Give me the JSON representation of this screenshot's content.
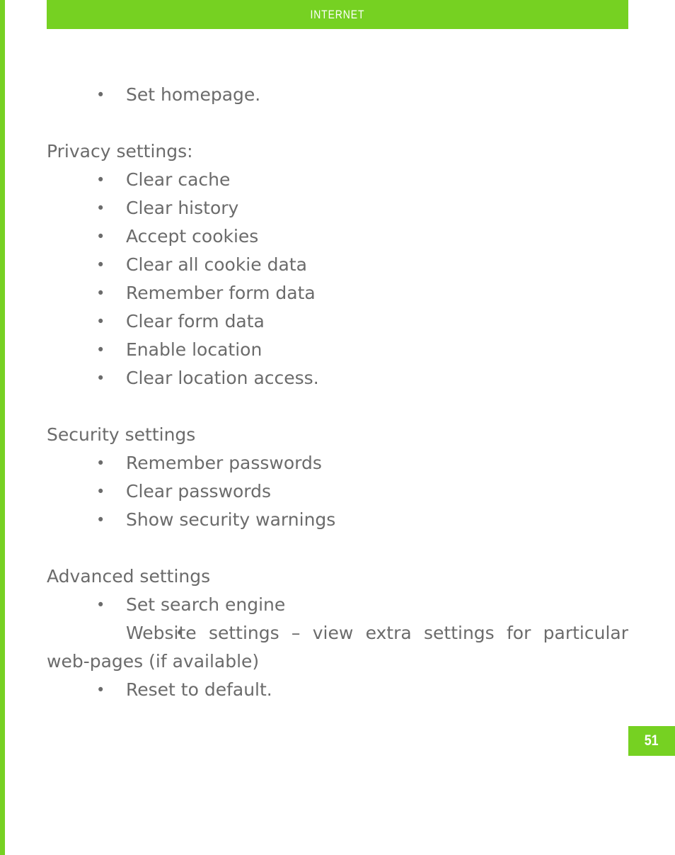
{
  "colors": {
    "accent_green": "#76d122",
    "body_text": "#6b6b6b",
    "page_background": "#ffffff",
    "header_text": "#ffffff"
  },
  "header": {
    "running_title": "INTERNET"
  },
  "content": {
    "intro_bullets": [
      "Set homepage."
    ],
    "sections": [
      {
        "heading": "Privacy settings:",
        "items": [
          "Clear cache",
          "Clear history",
          "Accept cookies",
          "Clear all cookie data",
          "Remember form data",
          "Clear form data",
          "Enable location",
          "Clear location access."
        ]
      },
      {
        "heading": "Security settings",
        "items": [
          "Remember passwords",
          "Clear passwords",
          "Show security warnings"
        ]
      },
      {
        "heading": "Advanced settings",
        "items": [
          "Set search engine",
          "Website settings – view extra settings for particular web-pages (if available)",
          "Reset to default."
        ]
      }
    ]
  },
  "footer": {
    "page_number": "51"
  }
}
